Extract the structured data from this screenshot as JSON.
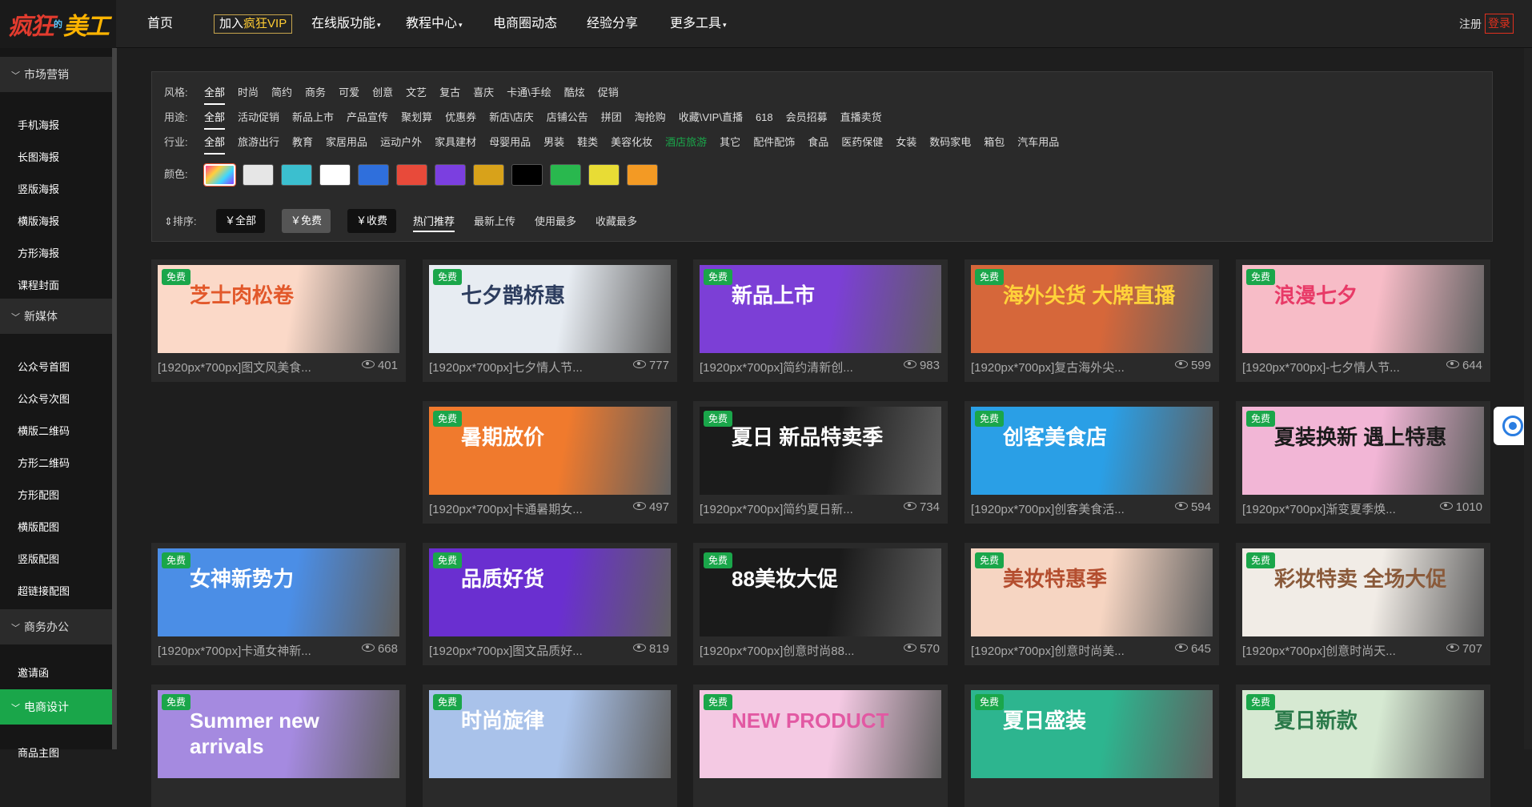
{
  "logo": {
    "part1": "疯狂",
    "dot": "的",
    "part2": "美工"
  },
  "nav": {
    "home": "首页",
    "vip_prefix": "加入",
    "vip_highlight": "疯狂VIP",
    "online": "在线版功能",
    "tutorial": "教程中心",
    "news": "电商圈动态",
    "share": "经验分享",
    "more": "更多工具",
    "caret": "▾",
    "register": "注册",
    "login": "登录"
  },
  "sidebar": {
    "groups": [
      {
        "label": "市场营销",
        "chev": "﹀"
      },
      {
        "label": "新媒体",
        "chev": "﹀"
      },
      {
        "label": "商务办公",
        "chev": "﹀"
      },
      {
        "label": "电商设计",
        "chev": "﹀"
      }
    ],
    "items": [
      "手机海报",
      "长图海报",
      "竖版海报",
      "横版海报",
      "方形海报",
      "课程封面",
      "公众号首图",
      "公众号次图",
      "横版二维码",
      "方形二维码",
      "方形配图",
      "横版配图",
      "竖版配图",
      "超链接配图",
      "邀请函",
      "商品主图"
    ]
  },
  "filters": {
    "style_label": "风格:",
    "style": [
      "全部",
      "时尚",
      "简约",
      "商务",
      "可爱",
      "创意",
      "文艺",
      "复古",
      "喜庆",
      "卡通\\手绘",
      "酷炫",
      "促销"
    ],
    "usage_label": "用途:",
    "usage": [
      "全部",
      "活动促销",
      "新品上市",
      "产品宣传",
      "聚划算",
      "优惠券",
      "新店\\店庆",
      "店铺公告",
      "拼团",
      "淘抢购",
      "收藏\\VIP\\直播",
      "618",
      "会员招募",
      "直播卖货"
    ],
    "industry_label": "行业:",
    "industry": [
      "全部",
      "旅游出行",
      "教育",
      "家居用品",
      "运动户外",
      "家具建材",
      "母婴用品",
      "男装",
      "鞋类",
      "美容化妆",
      "酒店旅游",
      "其它",
      "配件配饰",
      "食品",
      "医药保健",
      "女装",
      "数码家电",
      "箱包",
      "汽车用品"
    ],
    "color_label": "颜色:",
    "colors": [
      "gradient",
      "#e6e6e6",
      "#3bbfcf",
      "#ffffff",
      "#2f6fdc",
      "#e84a3a",
      "#7b3fe0",
      "#d8a21a",
      "#000000",
      "#29b84e",
      "#e8dc35",
      "#f39a24"
    ],
    "sort_label": "排序:",
    "sort_buttons": [
      "￥全部",
      "￥免费",
      "￥收费"
    ],
    "sort_tabs": [
      "热门推荐",
      "最新上传",
      "使用最多",
      "收藏最多"
    ]
  },
  "cards": [
    {
      "badge": "免费",
      "title": "[1920px*700px]图文风美食...",
      "views": "401",
      "big": "芝士肉松卷",
      "bg": "#fbd9c8",
      "fg": "#e2582a"
    },
    {
      "badge": "免费",
      "title": "[1920px*700px]七夕情人节...",
      "views": "777",
      "big": "七夕鹊桥惠",
      "bg": "#e7ecf2",
      "fg": "#2c3c5e"
    },
    {
      "badge": "免费",
      "title": "[1920px*700px]简约清新创...",
      "views": "983",
      "big": "新品上市",
      "bg": "#7c3fd6",
      "fg": "#ffffff"
    },
    {
      "badge": "免费",
      "title": "[1920px*700px]复古海外尖...",
      "views": "599",
      "big": "海外尖货 大牌直播",
      "bg": "#d6673a",
      "fg": "#ffd23a"
    },
    {
      "badge": "免费",
      "title": "[1920px*700px]-七夕情人节...",
      "views": "644",
      "big": "浪漫七夕",
      "bg": "#f7bcc7",
      "fg": "#e83a67"
    },
    {
      "badge": "免费",
      "title": "[1920px*700px]卡通暑期女...",
      "views": "497",
      "big": "暑期放价",
      "bg": "#f07a2d",
      "fg": "#ffffff"
    },
    {
      "badge": "免费",
      "title": "[1920px*700px]简约夏日新...",
      "views": "734",
      "big": "夏日 新品特卖季",
      "bg": "#1b1b1b",
      "fg": "#ffffff"
    },
    {
      "badge": "免费",
      "title": "[1920px*700px]创客美食活...",
      "views": "594",
      "big": "创客美食店",
      "bg": "#2a9fe6",
      "fg": "#ffffff"
    },
    {
      "badge": "免费",
      "title": "[1920px*700px]渐变夏季焕...",
      "views": "1010",
      "big": "夏装换新 遇上特惠",
      "bg": "#f2b6d6",
      "fg": "#1b1b1b"
    },
    {
      "badge": "免费",
      "title": "[1920px*700px]卡通女神新...",
      "views": "668",
      "big": "女神新势力",
      "bg": "#4b8ee6",
      "fg": "#ffffff"
    },
    {
      "badge": "免费",
      "title": "[1920px*700px]图文品质好...",
      "views": "819",
      "big": "品质好货",
      "bg": "#6a2fd0",
      "fg": "#ffffff"
    },
    {
      "badge": "免费",
      "title": "[1920px*700px]创意时尚88...",
      "views": "570",
      "big": "88美妆大促",
      "bg": "#1a1a1a",
      "fg": "#ffffff"
    },
    {
      "badge": "免费",
      "title": "[1920px*700px]创意时尚美...",
      "views": "645",
      "big": "美妆特惠季",
      "bg": "#f6d5c2",
      "fg": "#b44e2f"
    },
    {
      "badge": "免费",
      "title": "[1920px*700px]创意时尚天...",
      "views": "707",
      "big": "彩妆特卖 全场大促",
      "bg": "#f1ece6",
      "fg": "#8a5a3a"
    },
    {
      "badge": "免费",
      "title": "",
      "views": "",
      "big": "Summer new arrivals",
      "bg": "#a58ae0",
      "fg": "#ffffff"
    },
    {
      "badge": "免费",
      "title": "",
      "views": "",
      "big": "时尚旋律",
      "bg": "#a9c2ea",
      "fg": "#ffffff"
    },
    {
      "badge": "免费",
      "title": "",
      "views": "",
      "big": "NEW PRODUCT",
      "bg": "#f4c9e3",
      "fg": "#e259a3"
    },
    {
      "badge": "免费",
      "title": "",
      "views": "",
      "big": "夏日盛装",
      "bg": "#2db58f",
      "fg": "#ffffff"
    },
    {
      "badge": "免费",
      "title": "",
      "views": "",
      "big": "夏日新款",
      "bg": "#d6e9d2",
      "fg": "#2b7a4a"
    }
  ]
}
